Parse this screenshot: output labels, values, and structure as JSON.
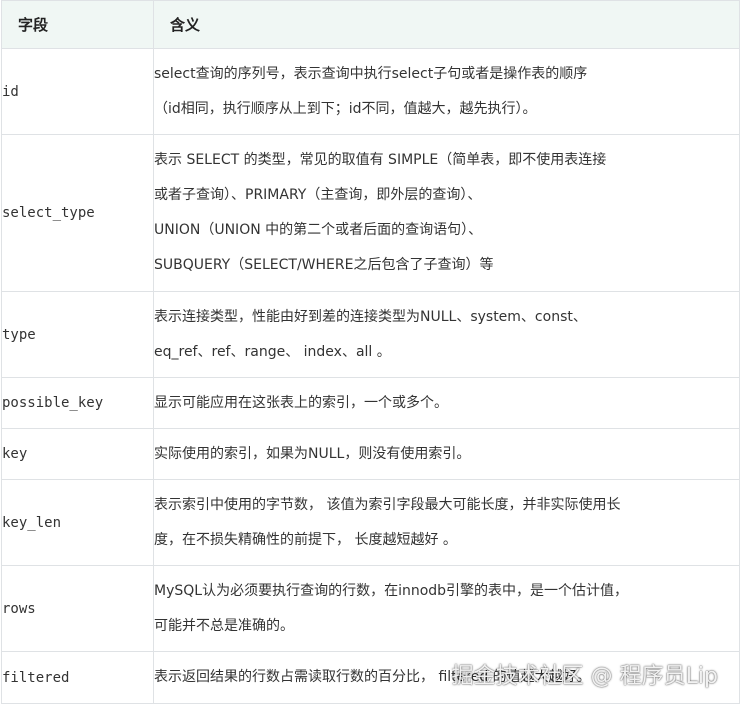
{
  "header": {
    "field": "字段",
    "meaning": "含义"
  },
  "rows": [
    {
      "field": "id",
      "lines": [
        "select查询的序列号，表示查询中执行select子句或者是操作表的顺序",
        "（id相同，执行顺序从上到下；id不同，值越大，越先执行）。"
      ]
    },
    {
      "field": "select_type",
      "lines": [
        "表示 SELECT 的类型，常见的取值有 SIMPLE（简单表，即不使用表连接",
        "或者子查询）、PRIMARY（主查询，即外层的查询）、",
        "UNION（UNION 中的第二个或者后面的查询语句）、",
        "SUBQUERY（SELECT/WHERE之后包含了子查询）等"
      ]
    },
    {
      "field": "type",
      "lines": [
        "表示连接类型，性能由好到差的连接类型为NULL、system、const、",
        "eq_ref、ref、range、 index、all 。"
      ]
    },
    {
      "field": "possible_key",
      "lines": [
        "显示可能应用在这张表上的索引，一个或多个。"
      ]
    },
    {
      "field": "key",
      "lines": [
        "实际使用的索引，如果为NULL，则没有使用索引。"
      ]
    },
    {
      "field": "key_len",
      "lines": [
        "表示索引中使用的字节数， 该值为索引字段最大可能长度，并非实际使用长",
        "度，在不损失精确性的前提下， 长度越短越好 。"
      ]
    },
    {
      "field": "rows",
      "lines": [
        "MySQL认为必须要执行查询的行数，在innodb引擎的表中，是一个估计值，",
        "可能并不总是准确的。"
      ]
    },
    {
      "field": "filtered",
      "lines": [
        "表示返回结果的行数占需读取行数的百分比， filtered 的值越大越好。"
      ]
    }
  ],
  "watermark": "掘金技术社区 @ 程序员Lip"
}
